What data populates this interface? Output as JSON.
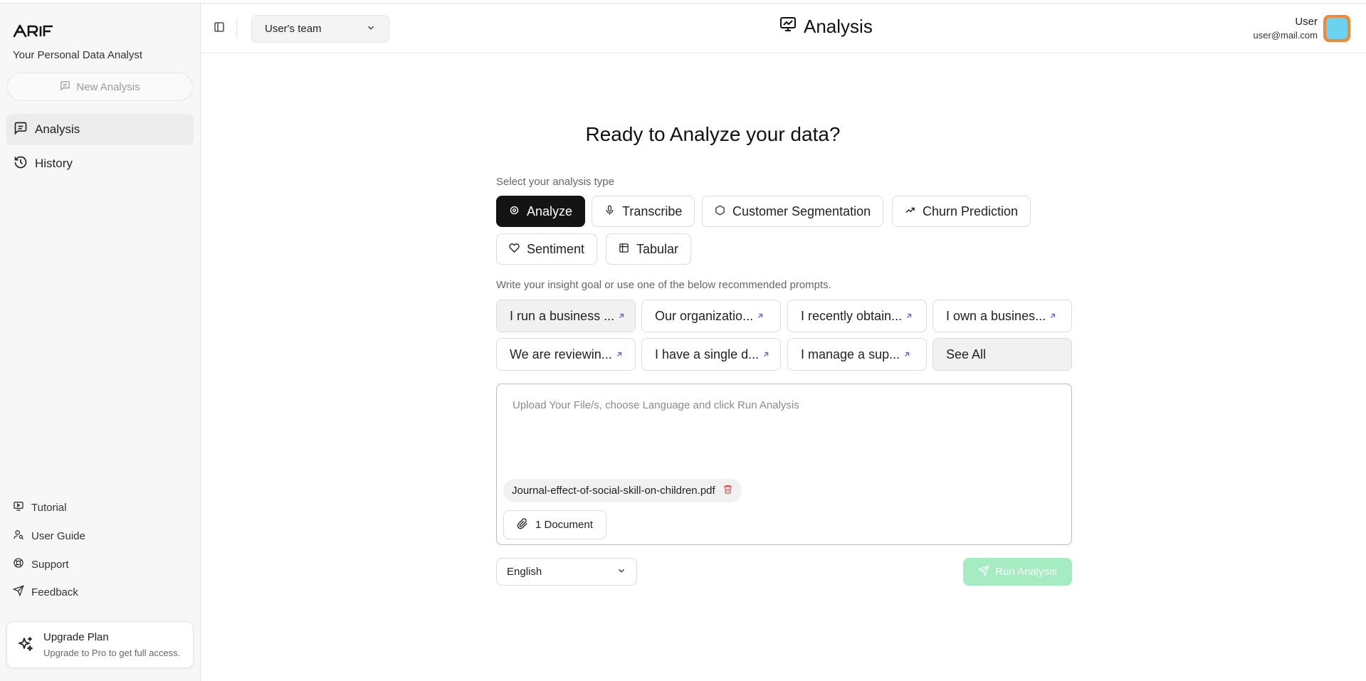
{
  "app": {
    "logo_text": "ARIF",
    "tagline": "Your Personal Data Analyst"
  },
  "sidebar": {
    "new_analysis_label": "New Analysis",
    "nav": [
      {
        "label": "Analysis",
        "icon": "message-square-icon",
        "active": true
      },
      {
        "label": "History",
        "icon": "history-icon",
        "active": false
      }
    ],
    "footer_links": [
      {
        "label": "Tutorial",
        "icon": "presentation-icon"
      },
      {
        "label": "User Guide",
        "icon": "user-guide-icon"
      },
      {
        "label": "Support",
        "icon": "lifebuoy-icon"
      },
      {
        "label": "Feedback",
        "icon": "send-icon"
      }
    ],
    "upgrade": {
      "title": "Upgrade Plan",
      "subtitle": "Upgrade to Pro to get full access."
    }
  },
  "header": {
    "team_select": "User's team",
    "page_title": "Analysis",
    "user_name": "User",
    "user_email": "user@mail.com"
  },
  "main": {
    "heading": "Ready to Analyze your data?",
    "type_label": "Select your analysis type",
    "analysis_types": [
      {
        "label": "Analyze",
        "icon": "target-icon",
        "selected": true
      },
      {
        "label": "Transcribe",
        "icon": "mic-icon",
        "selected": false
      },
      {
        "label": "Customer Segmentation",
        "icon": "hexagon-icon",
        "selected": false
      },
      {
        "label": "Churn Prediction",
        "icon": "trending-up-icon",
        "selected": false
      },
      {
        "label": "Sentiment",
        "icon": "heart-icon",
        "selected": false
      },
      {
        "label": "Tabular",
        "icon": "table-icon",
        "selected": false
      }
    ],
    "goal_label": "Write your insight goal or use one of the below recommended prompts.",
    "prompts": [
      "I run a business ...",
      "Our organizatio...",
      "I recently obtain...",
      "I own a busines...",
      "We are reviewin...",
      "I have a single d...",
      "I manage a sup..."
    ],
    "see_all_label": "See All",
    "upload_placeholder": "Upload Your File/s, choose Language and click Run Analysis",
    "file_name": "Journal-effect-of-social-skill-on-children.pdf",
    "document_count_label": "1 Document",
    "language": "English",
    "run_label": "Run Analysis"
  },
  "colors": {
    "accent_dark": "#141414",
    "run_button": "#a6ecc3",
    "drop_border": "#d9a7e8",
    "prompt_arrow": "#6c5ce7",
    "delete_icon": "#e24b4b"
  }
}
